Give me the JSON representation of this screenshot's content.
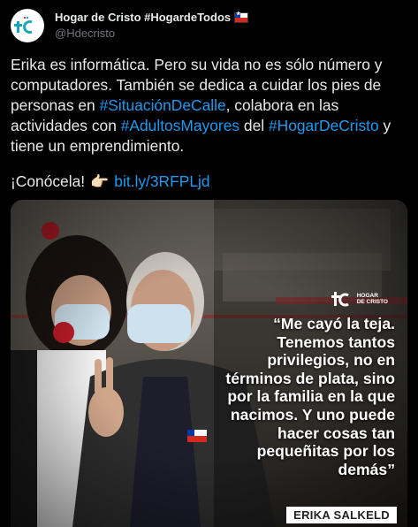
{
  "account": {
    "display_name": "Hogar de Cristo #HogardeTodos",
    "handle": "@Hdecristo",
    "flag_icon": "chile-flag-icon",
    "brand_color": "#1aa6b8"
  },
  "tweet": {
    "body_parts": [
      {
        "text": "Erika es informática. Pero su vida no es sólo número y computadores. También se dedica a cuidar los pies de personas en ",
        "type": "text"
      },
      {
        "text": "#SituaciónDeCalle",
        "type": "hashtag"
      },
      {
        "text": ", colabora en las actividades con ",
        "type": "text"
      },
      {
        "text": "#AdultosMayores",
        "type": "hashtag"
      },
      {
        "text": " del ",
        "type": "text"
      },
      {
        "text": "#HogarDeCristo",
        "type": "hashtag"
      },
      {
        "text": " y tiene un emprendimiento.",
        "type": "text"
      }
    ],
    "cta_text": "¡Conócela!",
    "cta_icon": "backhand-pointing-right-icon",
    "cta_link": "bit.ly/3RFPLjd",
    "link_color": "#1d9bf0"
  },
  "media": {
    "logo_line1": "HOGAR",
    "logo_line2": "DE CRISTO",
    "quote": "“Me cayó la teja. Tenemos tantos privilegios, no en términos de plata, sino por la familia en la que nacimos. Y uno puede hacer cosas tan pequeñitas por los demás”",
    "credit": "ERIKA SALKELD"
  }
}
